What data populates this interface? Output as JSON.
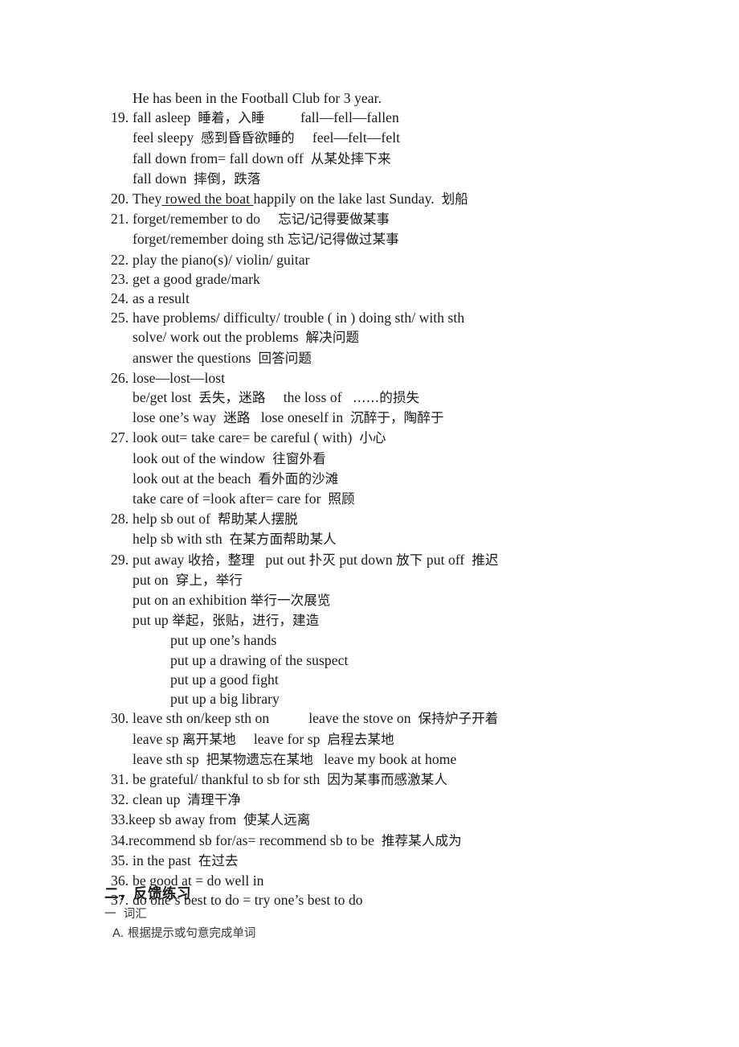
{
  "document": {
    "background_color": "#ffffff",
    "text_color": "#1a1a1a",
    "lead_sentence": "He has been in the Football Club for 3 year."
  },
  "entries": {
    "n19": "19.",
    "n19_l1_a": "fall asleep  ",
    "n19_l1_cn": "睡着，入睡",
    "n19_l1_b": "          fall—fell—fallen",
    "n19_l2_a": "feel sleepy  ",
    "n19_l2_cn": "感到昏昏欲睡的",
    "n19_l2_b": "     feel—felt—felt",
    "n19_l3_a": "fall down from= fall down off  ",
    "n19_l3_cn": "从某处摔下来",
    "n19_l4_a": "fall down  ",
    "n19_l4_cn": "摔倒，跌落",
    "n20": "20.",
    "n20_a": "They",
    "n20_u": " rowed the boat ",
    "n20_b": "happily on the lake last Sunday.  ",
    "n20_cn": "划船",
    "n21": "21.",
    "n21_l1_a": "forget/remember to do     ",
    "n21_l1_cn": "忘记/记得要做某事",
    "n21_l2_a": "forget/remember doing sth ",
    "n21_l2_cn": "忘记/记得做过某事",
    "n22": "22.",
    "n22_a": "play the piano(s)/ violin/ guitar",
    "n23": "23.",
    "n23_a": "get a good grade/mark",
    "n24": "24.",
    "n24_a": "as a result",
    "n25": "25.",
    "n25_l1_a": "have problems/ difficulty/ trouble ( in ) doing sth/ with sth",
    "n25_l2_a": "solve/ work out the problems  ",
    "n25_l2_cn": "解决问题",
    "n25_l3_a": "answer the questions  ",
    "n25_l3_cn": "回答问题",
    "n26": "26.",
    "n26_l1_a": "lose—lost—lost",
    "n26_l2_a": "be/get lost  ",
    "n26_l2_cn": "丢失，迷路",
    "n26_l2_b": "     the loss of   ",
    "n26_l2_cn2": "……的损失",
    "n26_l3_a": "lose one’s way  ",
    "n26_l3_cn": "迷路",
    "n26_l3_b": "   lose oneself in  ",
    "n26_l3_cn2": "沉醉于，陶醉于",
    "n27": "27.",
    "n27_l1_a": "look out= take care= be careful ( with)  ",
    "n27_l1_cn": "小心",
    "n27_l2_a": "look out of the window  ",
    "n27_l2_cn": "往窗外看",
    "n27_l3_a": "look out at the beach  ",
    "n27_l3_cn": "看外面的沙滩",
    "n27_l4_a": "take care of =look after= care for  ",
    "n27_l4_cn": "照顾",
    "n28": "28.",
    "n28_l1_a": "help sb out of  ",
    "n28_l1_cn": "帮助某人摆脱",
    "n28_l2_a": "help sb with sth  ",
    "n28_l2_cn": "在某方面帮助某人",
    "n29": "29.",
    "n29_l1_a": "put away ",
    "n29_l1_cn": "收拾，整理",
    "n29_l1_b": "   put out ",
    "n29_l1_cn2": "扑灭",
    "n29_l1_c": " put down ",
    "n29_l1_cn3": "放下",
    "n29_l1_d": " put off  ",
    "n29_l1_cn4": "推迟",
    "n29_l2_a": "put on  ",
    "n29_l2_cn": "穿上，举行",
    "n29_l3_a": "put on an exhibition ",
    "n29_l3_cn": "举行一次展览",
    "n29_l4_a": "put up ",
    "n29_l4_cn": "举起，张贴，进行，建造",
    "n29_sub1": "put up one’s hands",
    "n29_sub2": "put up a drawing of the suspect",
    "n29_sub3": "put up a good fight",
    "n29_sub4": "put up a big library",
    "n30": "30.",
    "n30_l1_a": "leave sth on/keep sth on           leave the stove on  ",
    "n30_l1_cn": "保持炉子开着",
    "n30_l2_a": "leave sp ",
    "n30_l2_cn": "离开某地",
    "n30_l2_b": "     leave for sp  ",
    "n30_l2_cn2": "启程去某地",
    "n30_l3_a": "leave sth sp  ",
    "n30_l3_cn": "把某物遗忘在某地",
    "n30_l3_b": "   leave my book at home",
    "n31": "31.",
    "n31_a": "be grateful/ thankful to sb for sth  ",
    "n31_cn": "因为某事而感激某人",
    "n32": "32.",
    "n32_a": "clean up  ",
    "n32_cn": "清理干净",
    "n33": "33.",
    "n33_a": "keep sb away from  ",
    "n33_cn": "使某人远离",
    "n34": "34.",
    "n34_a": "recommend sb for/as= recommend sb to be  ",
    "n34_cn": "推荐某人成为",
    "n35": "35.",
    "n35_a": "in the past  ",
    "n35_cn": "在过去",
    "n36": "36.",
    "n36_a": "be good at = do well in",
    "n37": "37.",
    "n37_a": "do one’s best to do = try one’s best to do"
  },
  "tail": {
    "section_heading": "二，反馈练习",
    "subsection": "一  词汇",
    "task": "A. 根据提示或句意完成单词"
  }
}
